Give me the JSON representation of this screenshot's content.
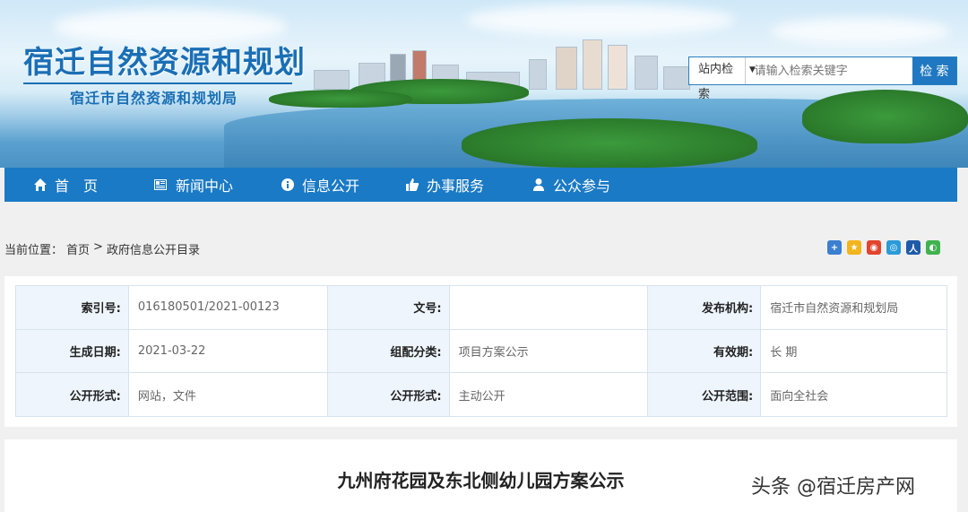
{
  "banner": {
    "title": "宿迁自然资源和规划",
    "subtitle": "宿迁市自然资源和规划局"
  },
  "search": {
    "scope_label": "站内检索",
    "placeholder": "请输入检索关键字",
    "button_label": "检 索"
  },
  "nav": {
    "items": [
      {
        "label": "首　页",
        "icon": "home-icon"
      },
      {
        "label": "新闻中心",
        "icon": "newspaper-icon"
      },
      {
        "label": "信息公开",
        "icon": "info-icon"
      },
      {
        "label": "办事服务",
        "icon": "thumbs-up-icon"
      },
      {
        "label": "公众参与",
        "icon": "user-icon"
      }
    ]
  },
  "breadcrumb": {
    "prefix": "当前位置：",
    "home": "首页",
    "sep": ">",
    "current": "政府信息公开目录"
  },
  "share_icons": [
    "add-icon",
    "qzone-icon",
    "weibo-icon",
    "tencent-icon",
    "renren-icon",
    "wechat-icon"
  ],
  "meta": {
    "rows": [
      [
        {
          "label": "索引号:",
          "value": "016180501/2021-00123"
        },
        {
          "label": "文号:",
          "value": ""
        },
        {
          "label": "发布机构:",
          "value": "宿迁市自然资源和规划局"
        }
      ],
      [
        {
          "label": "生成日期:",
          "value": "2021-03-22"
        },
        {
          "label": "组配分类:",
          "value": "项目方案公示"
        },
        {
          "label": "有效期:",
          "value": "长 期"
        }
      ],
      [
        {
          "label": "公开形式:",
          "value": "网站，文件"
        },
        {
          "label": "公开形式:",
          "value": "主动公开"
        },
        {
          "label": "公开范围:",
          "value": "面向全社会"
        }
      ]
    ]
  },
  "article": {
    "title": "九州府花园及东北侧幼儿园方案公示"
  },
  "watermark": "头条 @宿迁房产网",
  "colors": {
    "nav_bg": "#1a7ac5",
    "title_blue": "#1a6fb5",
    "label_bg": "#eef5fc"
  }
}
